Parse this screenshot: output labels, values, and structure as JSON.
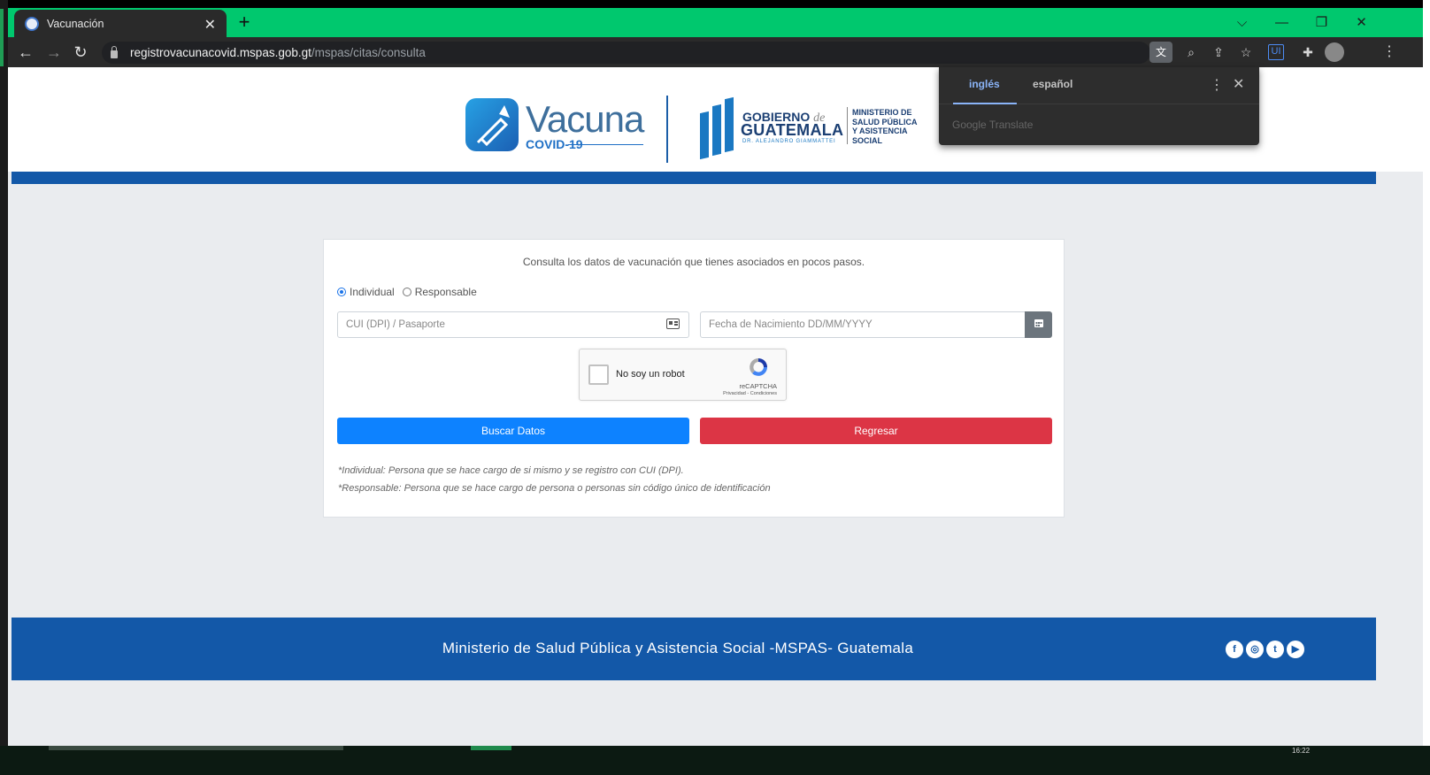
{
  "browser": {
    "tab_title": "Vacunación",
    "tab_close": "✕",
    "new_tab": "+",
    "window_controls": {
      "dropdown": "⌵",
      "minimize": "—",
      "restore": "❐",
      "close": "✕"
    },
    "url_host": "registrovacunacovid.mspas.gob.gt",
    "url_path": "/mspas/citas/consulta",
    "nav_back": "←",
    "nav_forward": "→",
    "nav_reload": "↻",
    "extension_label": "UI",
    "more_label": "⋮"
  },
  "translate_popup": {
    "tab_active": "inglés",
    "tab_inactive": "español",
    "menu": "⋮",
    "close": "✕",
    "footer": "Google Translate"
  },
  "header": {
    "vacuna_word": "Vacuna",
    "vacuna_sub": "COVID-19",
    "gob_line1_a": "GOBIERNO",
    "gob_line1_b": "de",
    "gob_line2": "GUATEMALA",
    "gob_line3": "DR. ALEJANDRO GIAMMATTEI",
    "ministry_lines": [
      "MINISTERIO DE",
      "SALUD PÚBLICA",
      "Y ASISTENCIA",
      "SOCIAL"
    ]
  },
  "form": {
    "intro": "Consulta los datos de vacunación que tienes asociados en pocos pasos.",
    "radio_individual": "Individual",
    "radio_responsable": "Responsable",
    "selected": "Individual",
    "cui_placeholder": "CUI (DPI) / Pasaporte",
    "date_placeholder": "Fecha de Nacimiento DD/MM/YYYY",
    "captcha_label": "No soy un robot",
    "captcha_brand": "reCAPTCHA",
    "captcha_links": "Privacidad - Condiciones",
    "search_button": "Buscar Datos",
    "back_button": "Regresar",
    "note_individual": "*Individual: Persona que se hace cargo de si mismo y se registro con CUI (DPI).",
    "note_responsable": "*Responsable: Persona que se hace cargo de persona o personas sin código único de identificación"
  },
  "footer": {
    "text": "Ministerio de Salud Pública y Asistencia Social -MSPAS- Guatemala",
    "social": [
      "facebook-icon",
      "instagram-icon",
      "twitter-icon",
      "youtube-icon"
    ]
  },
  "taskbar": {
    "clock": "16:22"
  },
  "colors": {
    "tabbar": "#00c86e",
    "brand_blue": "#1358a8",
    "search": "#0d82ff",
    "back": "#dc3545"
  }
}
